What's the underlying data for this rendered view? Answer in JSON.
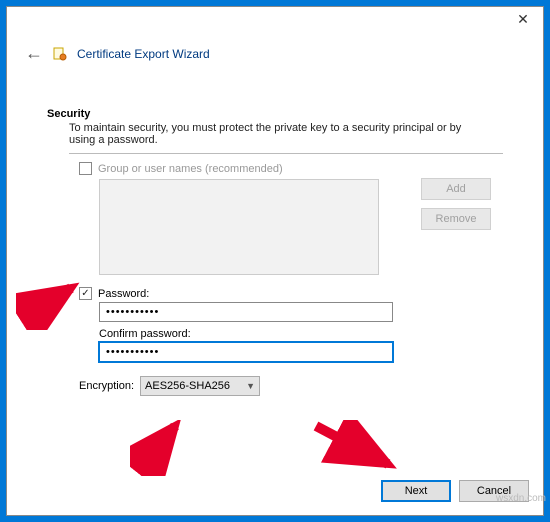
{
  "window": {
    "close_glyph": "✕",
    "back_glyph": "←"
  },
  "wizard": {
    "title": "Certificate Export Wizard"
  },
  "security": {
    "heading": "Security",
    "description": "To maintain security, you must protect the private key to a security principal or by using a password."
  },
  "groupOption": {
    "checked": false,
    "label": "Group or user names (recommended)"
  },
  "buttons": {
    "add": "Add",
    "remove": "Remove",
    "next": "Next",
    "cancel": "Cancel"
  },
  "passwordOption": {
    "checked": true,
    "label": "Password:",
    "value": "•••••••••••",
    "confirm_label": "Confirm password:",
    "confirm_value": "•••••••••••"
  },
  "encryption": {
    "label": "Encryption:",
    "selected": "AES256-SHA256"
  },
  "watermark": "wsxdn.com"
}
